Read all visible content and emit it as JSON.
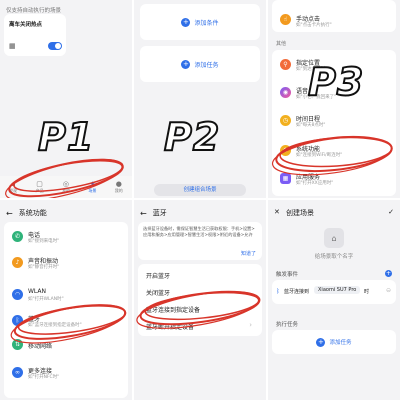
{
  "labels": {
    "p1": "P1",
    "p2": "P2",
    "p3": "P3"
  },
  "p1": {
    "header": "仅支持自动执行的场景",
    "scene_title": "离车关闭热点",
    "tabs": [
      "发现",
      "产品",
      "我的",
      "场景",
      "我的"
    ]
  },
  "p2": {
    "add_condition": "添加条件",
    "add_task": "添加任务",
    "create_button": "创建组合场景"
  },
  "p3": {
    "items_top": [
      {
        "title": "",
        "sub": ""
      },
      {
        "title": "手动点击",
        "sub": "如\"点击卡片执行\""
      }
    ],
    "section": "其他",
    "items": [
      {
        "title": "指定位置",
        "sub": "如\"到达公司时\""
      },
      {
        "title": "语音",
        "sub": "如\"小艺：我回来了\""
      },
      {
        "title": "时间日程",
        "sub": "如\"每天8点时\""
      },
      {
        "title": "系统功能",
        "sub": "如\"连接到WiFi/断连时\""
      },
      {
        "title": "应用服务",
        "sub": "如\"打开XX应用时\""
      }
    ]
  },
  "p4": {
    "title": "系统功能",
    "items": [
      {
        "title": "电话",
        "sub": "如\"接到来电时\""
      },
      {
        "title": "声音和振动",
        "sub": "如\"静音打开时\""
      },
      {
        "title": "WLAN",
        "sub": "如\"打开WLAN时\""
      },
      {
        "title": "蓝牙",
        "sub": "如\"蓝牙连接到指定设备时\""
      },
      {
        "title": "移动网络",
        "sub": ""
      },
      {
        "title": "更多连接",
        "sub": "如\"打开NFC时\""
      }
    ]
  },
  "p5": {
    "title": "蓝牙",
    "notice": "选择蓝牙设备时，需保证智慧生活已获取权限：手机>设置>应用和服务>应用管理>智慧生活>权限>附近的设备>允许",
    "notice_link": "知道了",
    "items": [
      "开启蓝牙",
      "关闭蓝牙",
      "蓝牙连接到指定设备",
      "蓝牙断开指定设备"
    ]
  },
  "p6": {
    "title": "创建场景",
    "name_placeholder": "给场景取个名字",
    "trigger_section": "触发事件",
    "trigger_text": "蓝牙连接到",
    "trigger_device": "Xiaomi SU7 Pro",
    "trigger_suffix": "时",
    "task_section": "执行任务",
    "add_task": "添加任务"
  }
}
